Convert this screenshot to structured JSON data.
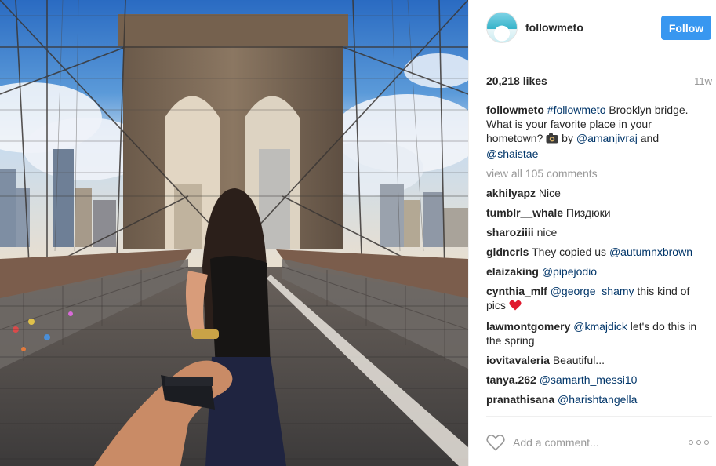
{
  "post": {
    "username": "followmeto",
    "follow_label": "Follow",
    "likes": "20,218 likes",
    "time_ago": "11w",
    "caption": {
      "user": "followmeto",
      "hashtag": "#followmeto",
      "text": " Brooklyn bridge. What is your favorite place in your hometown? ",
      "by": " by ",
      "mention1": "@amanjivraj",
      "and": " and ",
      "mention2": "@shaistae"
    },
    "view_all": "view all 105 comments",
    "comments": [
      {
        "user": "akhilyapz",
        "text": " Nice"
      },
      {
        "user": "tumblr__whale",
        "text": " Пиздюки"
      },
      {
        "user": "sharoziiii",
        "text": " nice"
      },
      {
        "user": "gldncrls",
        "text": " They copied us ",
        "mention": "@autumnxbrown"
      },
      {
        "user": "elaizaking",
        "mention": "@pipejodio"
      },
      {
        "user": "cynthia_mlf",
        "mention": "@george_shamy",
        "text": " this kind of pics "
      },
      {
        "user": "lawmontgomery",
        "mention": "@kmajdick",
        "text": " let's do this in the spring"
      },
      {
        "user": "iovitavaleria",
        "text": " Beautiful..."
      },
      {
        "user": "tanya.262",
        "mention": "@samarth_messi10"
      },
      {
        "user": "pranathisana",
        "mention": "@harishtangella"
      }
    ],
    "add_comment_placeholder": "Add a comment...",
    "icons": {
      "avatar": "avatar",
      "camera": "camera-emoji-icon",
      "heart_emoji": "red-heart-emoji-icon",
      "like": "heart-outline-icon",
      "more": "more-options-icon"
    },
    "colors": {
      "follow_button": "#3897f0",
      "link": "#003569",
      "muted": "#999999"
    }
  }
}
